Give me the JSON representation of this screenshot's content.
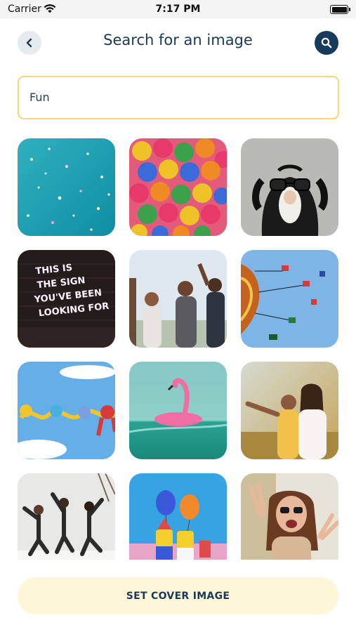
{
  "status_bar": {
    "carrier": "Carrier",
    "time": "7:17 PM"
  },
  "header": {
    "title": "Search for an image"
  },
  "search": {
    "value": "Fun",
    "placeholder": ""
  },
  "images": [
    {
      "subject": "confetti on teal background"
    },
    {
      "subject": "colorful gumballs"
    },
    {
      "subject": "dog wearing funny glasses"
    },
    {
      "subject": "neon sign on brick wall",
      "sign_lines": [
        "THIS IS",
        "THE SIGN",
        "YOU'VE BEEN",
        "LOOKING FOR"
      ]
    },
    {
      "subject": "friends laughing outdoors"
    },
    {
      "subject": "swing ride against blue sky"
    },
    {
      "subject": "toy monkeys chain against sky"
    },
    {
      "subject": "pink flamingo float on water"
    },
    {
      "subject": "friends taking selfie"
    },
    {
      "subject": "friends jumping in snow"
    },
    {
      "subject": "lego figures with balloons"
    },
    {
      "subject": "woman making peace sign"
    }
  ],
  "footer": {
    "button_label": "SET COVER IMAGE"
  },
  "colors": {
    "accent": "#173b5c",
    "input_border": "#f2d971",
    "button_bg": "#fdf6d9",
    "title": "#1c3a57"
  }
}
